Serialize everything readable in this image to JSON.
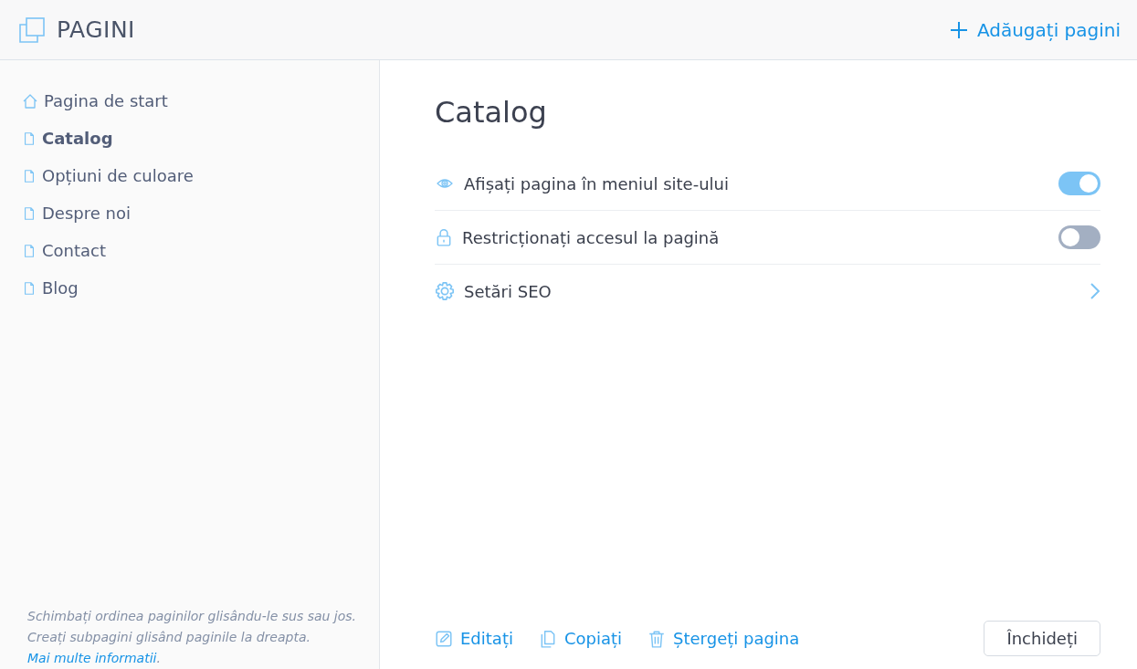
{
  "header": {
    "title": "PAGINI",
    "add_button": "Adăugați pagini"
  },
  "sidebar": {
    "items": [
      {
        "label": "Pagina de start",
        "kind": "home",
        "selected": false
      },
      {
        "label": "Catalog",
        "kind": "page",
        "selected": true
      },
      {
        "label": "Opțiuni de culoare",
        "kind": "page",
        "selected": false
      },
      {
        "label": "Despre noi",
        "kind": "page",
        "selected": false
      },
      {
        "label": "Contact",
        "kind": "page",
        "selected": false
      },
      {
        "label": "Blog",
        "kind": "page",
        "selected": false
      }
    ],
    "help": {
      "text": "Schimbați ordinea paginilor glisându-le sus sau jos. Creați subpagini glisând paginile la dreapta.",
      "link": "Mai multe informatii",
      "after": "."
    }
  },
  "page": {
    "title": "Catalog",
    "settings": [
      {
        "label": "Afișați pagina în meniul site-ului",
        "kind": "toggle",
        "on": true
      },
      {
        "label": "Restricționați accesul la pagină",
        "kind": "toggle",
        "on": false
      },
      {
        "label": "Setări SEO",
        "kind": "link"
      }
    ],
    "actions": [
      {
        "label": "Editați"
      },
      {
        "label": "Copiați"
      },
      {
        "label": "Ștergeți pagina"
      }
    ],
    "close_button": "Închideți"
  }
}
